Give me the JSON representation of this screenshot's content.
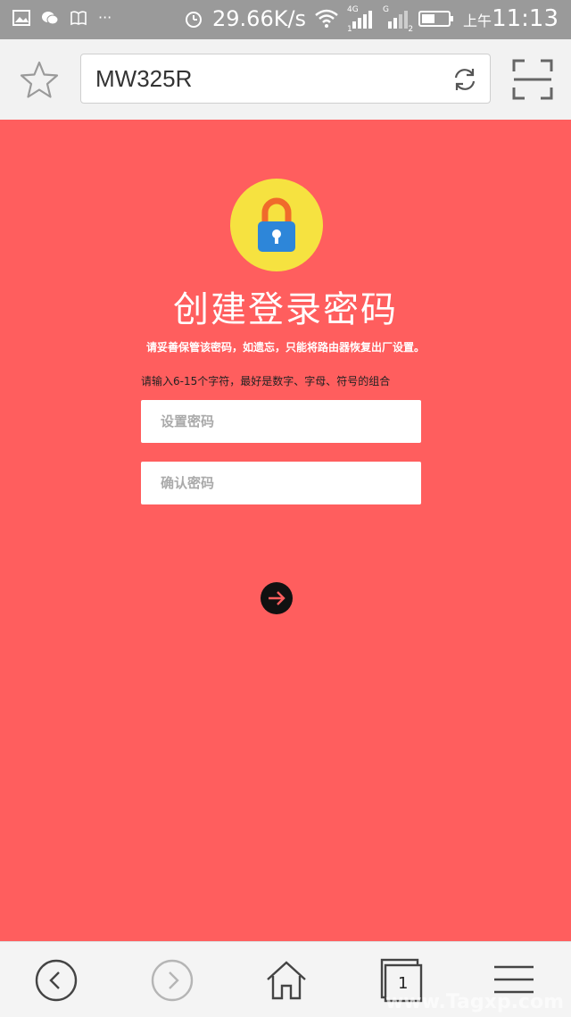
{
  "status_bar": {
    "speed": "29.66K/s",
    "network_labels": [
      "4G",
      "G",
      "1",
      "2"
    ],
    "am_pm": "上午",
    "time": "11:13"
  },
  "browser": {
    "url": "MW325R",
    "icons": [
      "star-icon",
      "refresh-icon",
      "scan-icon"
    ]
  },
  "page": {
    "title": "创建登录密码",
    "note": "请妥善保管该密码，如遗忘，只能将路由器恢复出厂设置。",
    "hint": "请输入6-15个字符，最好是数字、字母、符号的组合",
    "password_placeholder": "设置密码",
    "confirm_placeholder": "确认密码",
    "lock_colors": {
      "circle": "#f6e240",
      "shackle": "#f06a2b",
      "body": "#2d86d9"
    },
    "background_color": "#ff5e5e"
  },
  "bottom_bar": {
    "tabs_count": "1",
    "icons": [
      "back-icon",
      "forward-icon",
      "home-icon",
      "tabs-icon",
      "menu-icon"
    ]
  },
  "watermark": "www.Tagxp.com"
}
